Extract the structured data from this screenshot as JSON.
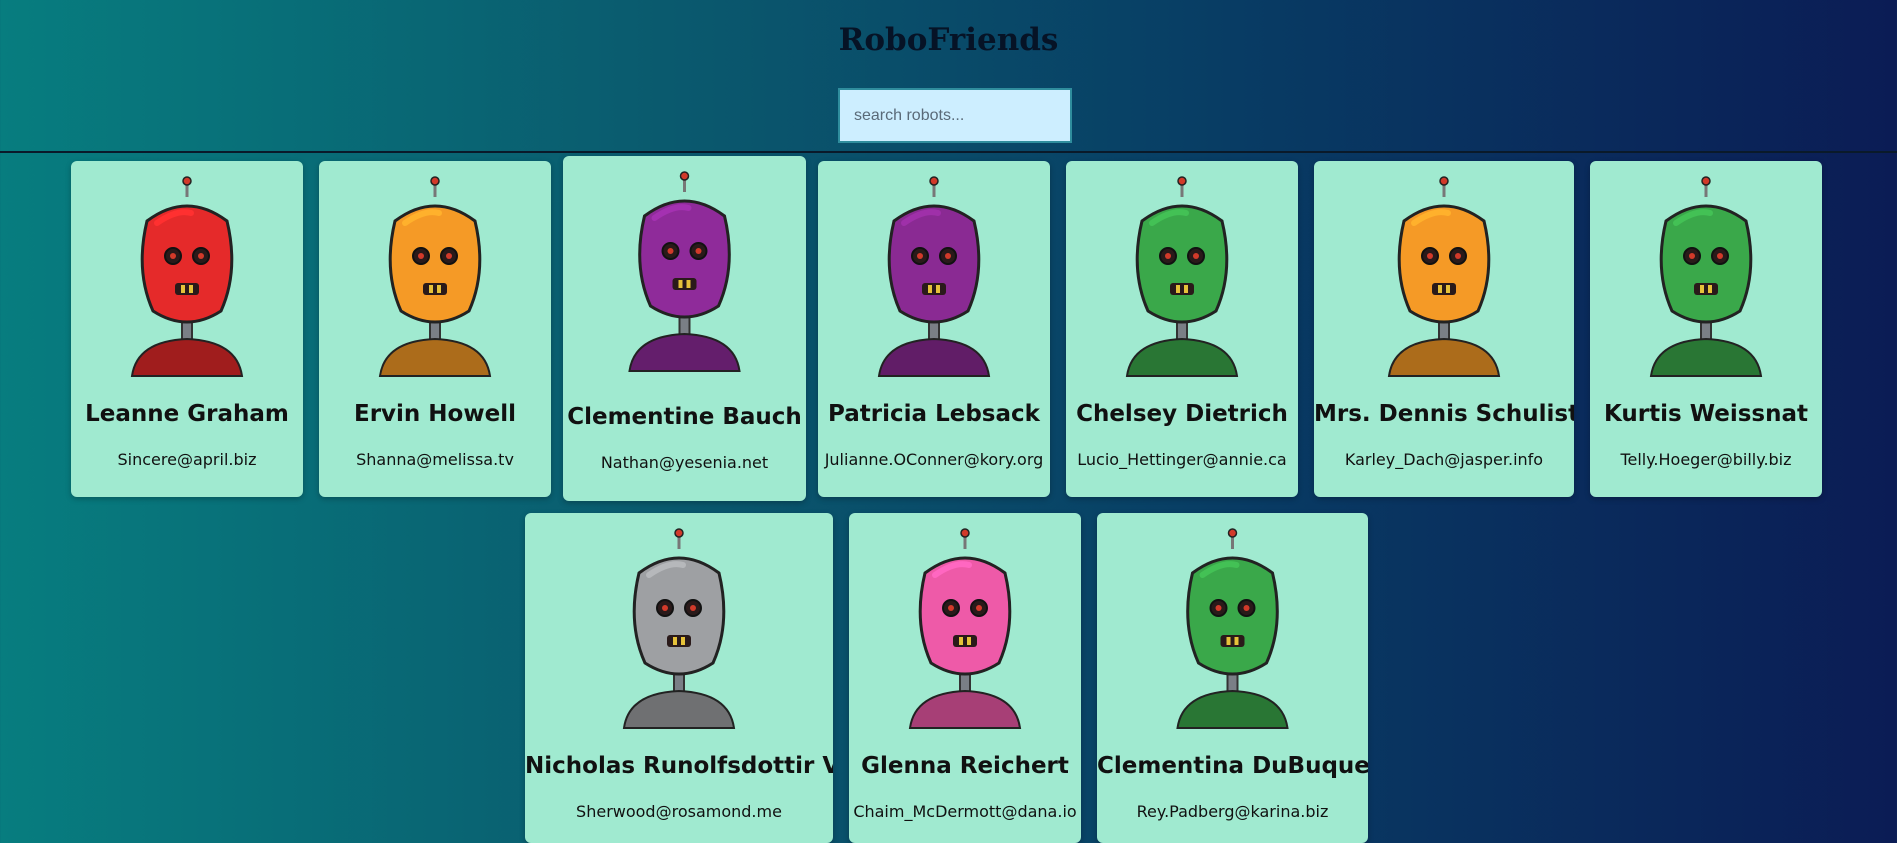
{
  "app": {
    "title": "RoboFriends"
  },
  "search": {
    "placeholder": "search robots..."
  },
  "robots": [
    {
      "name": "Leanne Graham",
      "email": "Sincere@april.biz",
      "color": "#e52a2a",
      "icon": "red-robot-avatar"
    },
    {
      "name": "Ervin Howell",
      "email": "Shanna@melissa.tv",
      "color": "#f59a26",
      "icon": "orange-robot-avatar"
    },
    {
      "name": "Clementine Bauch",
      "email": "Nathan@yesenia.net",
      "color": "#8f2b9a",
      "icon": "purple-robot-avatar"
    },
    {
      "name": "Patricia Lebsack",
      "email": "Julianne.OConner@kory.org",
      "color": "#8a2a93",
      "icon": "purple-robot-avatar"
    },
    {
      "name": "Chelsey Dietrich",
      "email": "Lucio_Hettinger@annie.ca",
      "color": "#3aa84a",
      "icon": "green-robot-avatar"
    },
    {
      "name": "Mrs. Dennis Schulist",
      "email": "Karley_Dach@jasper.info",
      "color": "#f59a26",
      "icon": "orange-robot-avatar"
    },
    {
      "name": "Kurtis Weissnat",
      "email": "Telly.Hoeger@billy.biz",
      "color": "#3aa84a",
      "icon": "green-robot-avatar"
    },
    {
      "name": "Nicholas Runolfsdottir V",
      "email": "Sherwood@rosamond.me",
      "color": "#9ea0a3",
      "icon": "gray-robot-avatar"
    },
    {
      "name": "Glenna Reichert",
      "email": "Chaim_McDermott@dana.io",
      "color": "#ee5aa8",
      "icon": "pink-robot-avatar"
    },
    {
      "name": "Clementina DuBuque",
      "email": "Rey.Padberg@karina.biz",
      "color": "#3aa84a",
      "icon": "green-robot-avatar"
    }
  ]
}
